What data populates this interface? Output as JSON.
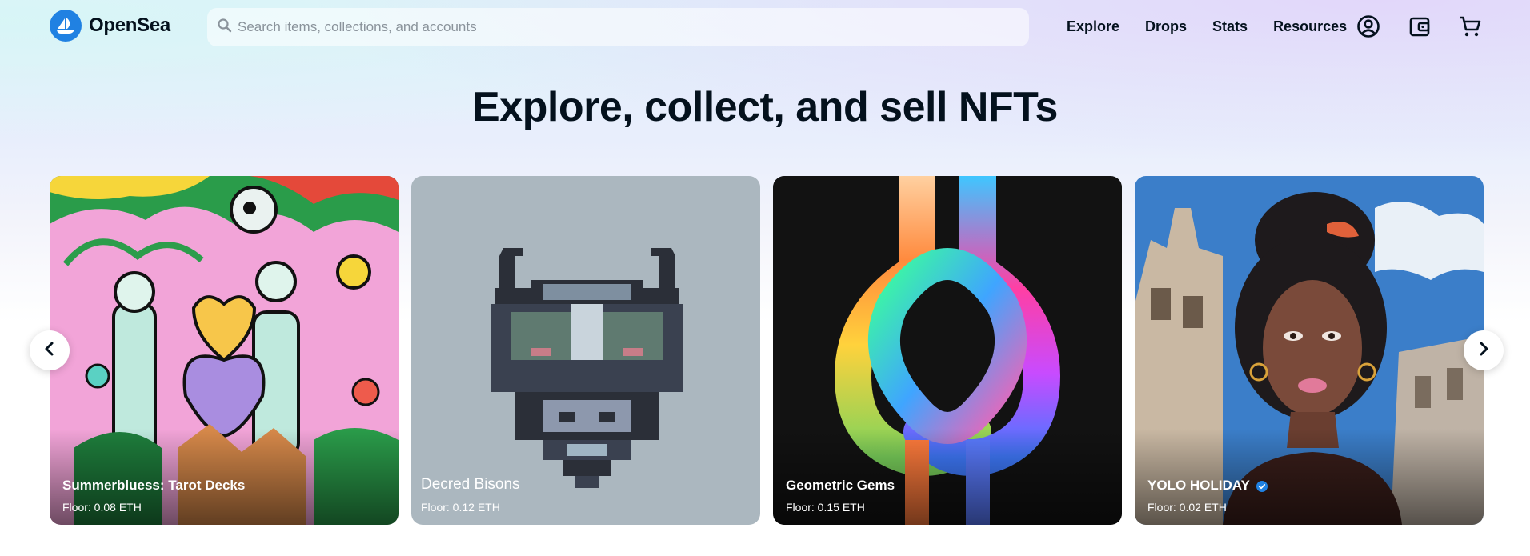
{
  "brand": {
    "name": "OpenSea",
    "accent": "#2081e2"
  },
  "search": {
    "placeholder": "Search items, collections, and accounts",
    "value": "",
    "icon": "search-icon"
  },
  "nav": {
    "items": [
      {
        "label": "Explore"
      },
      {
        "label": "Drops"
      },
      {
        "label": "Stats"
      },
      {
        "label": "Resources"
      }
    ]
  },
  "header_icons": {
    "profile": "user-circle-icon",
    "wallet": "wallet-icon",
    "cart": "cart-icon"
  },
  "hero": {
    "title": "Explore, collect, and sell NFTs"
  },
  "carousel": {
    "prev_icon": "chevron-left-icon",
    "next_icon": "chevron-right-icon",
    "cards": [
      {
        "name": "Summerbluess: Tarot Decks",
        "floor": "Floor: 0.08 ETH",
        "verified": false,
        "bg": "#f4a6d9"
      },
      {
        "name": "Decred Bisons",
        "floor": "Floor: 0.12 ETH",
        "verified": false,
        "bg": "#abb7bf"
      },
      {
        "name": "Geometric Gems",
        "floor": "Floor: 0.15 ETH",
        "verified": false,
        "bg": "#111111"
      },
      {
        "name": "YOLO HOLIDAY",
        "floor": "Floor: 0.02 ETH",
        "verified": true,
        "bg": "#3b7ec9"
      }
    ]
  }
}
